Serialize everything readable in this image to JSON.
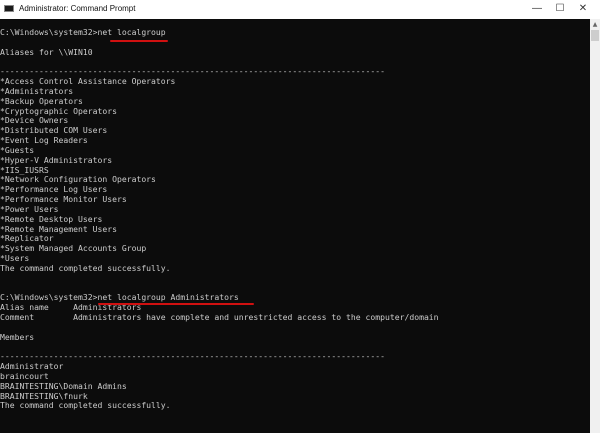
{
  "window": {
    "title": "Administrator: Command Prompt",
    "controls": {
      "minimize": "—",
      "maximize": "☐",
      "close": "✕"
    },
    "accent_underline_color": "#d01010"
  },
  "console_lines": [
    "C:\\Windows\\system32>net localgroup",
    "",
    "Aliases for \\\\WIN10",
    "",
    "-------------------------------------------------------------------------------",
    "*Access Control Assistance Operators",
    "*Administrators",
    "*Backup Operators",
    "*Cryptographic Operators",
    "*Device Owners",
    "*Distributed COM Users",
    "*Event Log Readers",
    "*Guests",
    "*Hyper-V Administrators",
    "*IIS_IUSRS",
    "*Network Configuration Operators",
    "*Performance Log Users",
    "*Performance Monitor Users",
    "*Power Users",
    "*Remote Desktop Users",
    "*Remote Management Users",
    "*Replicator",
    "*System Managed Accounts Group",
    "*Users",
    "The command completed successfully.",
    "",
    "",
    "C:\\Windows\\system32>net localgroup Administrators",
    "Alias name     Administrators",
    "Comment        Administrators have complete and unrestricted access to the computer/domain",
    "",
    "Members",
    "",
    "-------------------------------------------------------------------------------",
    "Administrator",
    "braincourt",
    "BRAINTESTING\\Domain Admins",
    "BRAINTESTING\\fnurk",
    "The command completed successfully."
  ]
}
